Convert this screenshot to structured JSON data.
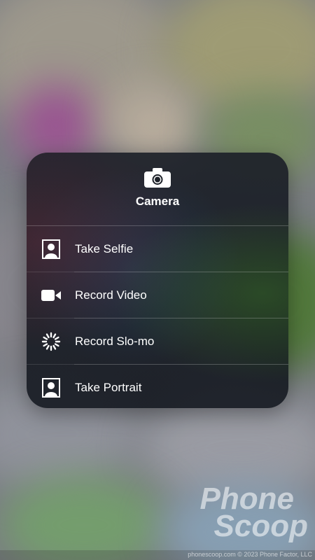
{
  "menu": {
    "title": "Camera",
    "items": [
      {
        "label": "Take Selfie",
        "icon": "selfie-icon"
      },
      {
        "label": "Record Video",
        "icon": "video-camera-icon"
      },
      {
        "label": "Record Slo-mo",
        "icon": "slomo-icon"
      },
      {
        "label": "Take Portrait",
        "icon": "portrait-icon"
      }
    ]
  },
  "watermark": {
    "line1": "Phone",
    "line2": "Scoop",
    "footer": "phonescoop.com  © 2023 Phone Factor, LLC"
  },
  "colors": {
    "menu_bg": "#1c2028",
    "text": "#ffffff"
  }
}
